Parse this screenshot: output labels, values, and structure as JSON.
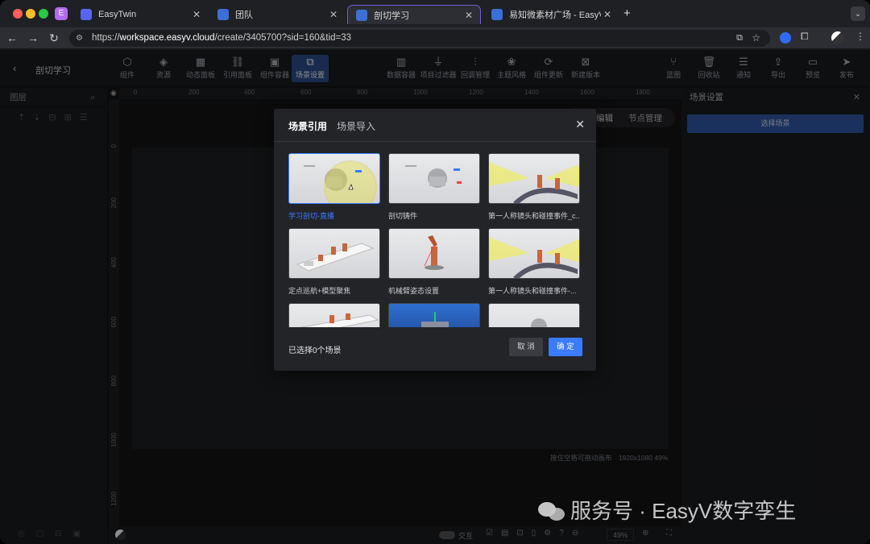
{
  "browser": {
    "tabs": [
      {
        "label": "EasyTwin",
        "fav": "#5865f2",
        "active": false
      },
      {
        "label": "团队",
        "fav": "#3a6fd8",
        "active": false
      },
      {
        "label": "剖切学习",
        "fav": "#3a6fd8",
        "active": true
      },
      {
        "label": "易知微素材广场 - EasyV数字孪",
        "fav": "#3a6fd8",
        "active": false
      }
    ],
    "url_prefix": "https://",
    "url_host": "workspace.easyv.cloud",
    "url_path": "/create/3405700?sid=160&tid=33"
  },
  "app": {
    "back_icon": "chevron-left-icon",
    "title": "剖切学习",
    "left_tools": [
      "组件",
      "资源",
      "动态面板",
      "引用面板",
      "组件容器",
      "场景设置"
    ],
    "center_tools": [
      "数据容器",
      "项目过滤器",
      "回调管理",
      "主题风格",
      "组件更新",
      "新建版本"
    ],
    "right_tools": [
      "蓝图",
      "回收站",
      "通知",
      "导出",
      "预览",
      "发布"
    ]
  },
  "left_panel": {
    "title": "图层"
  },
  "canvas": {
    "ruler_top": [
      "0",
      "200",
      "400",
      "600",
      "800",
      "1000",
      "1200",
      "1400",
      "1600",
      "1800"
    ],
    "ruler_left": [
      "0",
      "200",
      "400",
      "600",
      "800",
      "1000",
      "1200"
    ],
    "hint": "按住空格可拖动画布",
    "size": "1920x1080 49%",
    "edit_tab": "编辑",
    "node_tab": "节点管理",
    "interact_label": "交互",
    "zoom": "49%"
  },
  "right_panel": {
    "title": "场景设置",
    "select_button": "选择场景"
  },
  "modal": {
    "tabs": [
      "场景引用",
      "场景导入"
    ],
    "cards": [
      {
        "label": "学习剖切-直播",
        "selected": true
      },
      {
        "label": "剖切铸件",
        "selected": false
      },
      {
        "label": "第一人称镜头和碰撞事件_c...",
        "selected": false
      },
      {
        "label": "定点巡航+模型聚焦",
        "selected": false
      },
      {
        "label": "机械臂姿态设置",
        "selected": false
      },
      {
        "label": "第一人称镜头和碰撞事件-...",
        "selected": false
      },
      {
        "label": "",
        "selected": false
      },
      {
        "label": "",
        "selected": false
      },
      {
        "label": "",
        "selected": false
      }
    ],
    "selected_count_text": "已选择0个场景",
    "cancel": "取 消",
    "confirm": "确 定"
  },
  "watermark": "服务号 · EasyV数字孪生",
  "colors": {
    "accent": "#3a7bff",
    "tool_active": "#2d4f8e"
  }
}
